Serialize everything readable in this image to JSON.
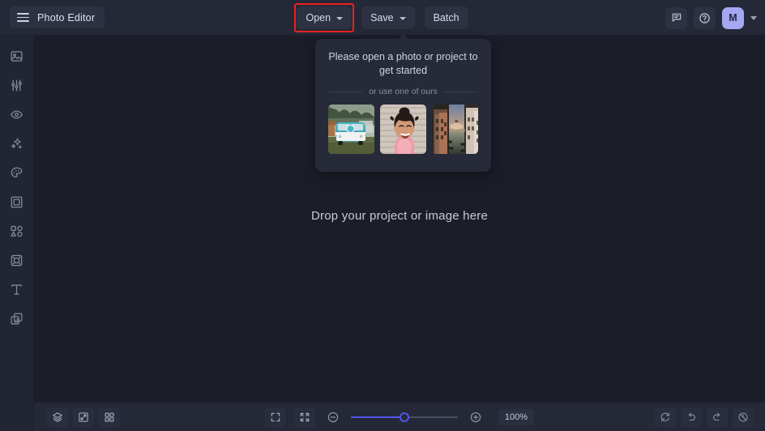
{
  "app": {
    "title": "Photo Editor",
    "menu_icon": "hamburger-icon",
    "bg_color": "#1b1d29",
    "header_color": "#252836",
    "accent_color": "#5156e8",
    "highlight_color": "#ef2020",
    "avatar_color": "#a5a7f2"
  },
  "header": {
    "tools": [
      {
        "label": "Open",
        "has_chevron": true,
        "highlighted": true
      },
      {
        "label": "Save",
        "has_chevron": true,
        "highlighted": false
      },
      {
        "label": "Batch",
        "has_chevron": false,
        "highlighted": false
      }
    ],
    "right": {
      "feedback_icon": "chat-bubble-icon",
      "help_icon": "question-circle-icon",
      "avatar_initial": "M",
      "avatar_chevron_icon": "chevron-down-icon"
    }
  },
  "sidebar": {
    "items": [
      {
        "name": "image-icon",
        "label": "Image"
      },
      {
        "name": "adjust-sliders-icon",
        "label": "Adjust"
      },
      {
        "name": "eye-icon",
        "label": "Effects"
      },
      {
        "name": "sparkles-icon",
        "label": "AI Tools"
      },
      {
        "name": "palette-icon",
        "label": "Color"
      },
      {
        "name": "frame-icon",
        "label": "Frame"
      },
      {
        "name": "shapes-icon",
        "label": "Elements"
      },
      {
        "name": "crop-rotate-icon",
        "label": "Transform"
      },
      {
        "name": "text-icon",
        "label": "Text"
      },
      {
        "name": "layers-copy-icon",
        "label": "Overlays"
      }
    ]
  },
  "canvas": {
    "drop_text": "Drop your project or image here"
  },
  "popup": {
    "title": "Please open a photo or project to get started",
    "divider_label": "or use one of ours",
    "samples": [
      {
        "name": "sample-thumbnail-vw-bus",
        "alt": "Teal VW camper van on grass"
      },
      {
        "name": "sample-thumbnail-portrait",
        "alt": "Smiling woman portrait"
      },
      {
        "name": "sample-thumbnail-canal",
        "alt": "Venice canal at sunset"
      }
    ]
  },
  "bottombar": {
    "left": [
      {
        "name": "layers-icon",
        "label": "Layers"
      },
      {
        "name": "compare-icon",
        "label": "Compare"
      },
      {
        "name": "grid-icon",
        "label": "Grid"
      }
    ],
    "center": {
      "fullscreen_icon": "fullscreen-icon",
      "fit-screen_icon": "fit-to-screen-icon",
      "zoom_out_icon": "minus-circle-icon",
      "zoom_in_icon": "plus-circle-icon",
      "slider_percent": 50,
      "zoom_level": "100%"
    },
    "right": [
      {
        "name": "reset-icon",
        "label": "Reset"
      },
      {
        "name": "undo-icon",
        "label": "Undo"
      },
      {
        "name": "redo-icon",
        "label": "Redo"
      },
      {
        "name": "history-icon",
        "label": "History"
      }
    ]
  }
}
